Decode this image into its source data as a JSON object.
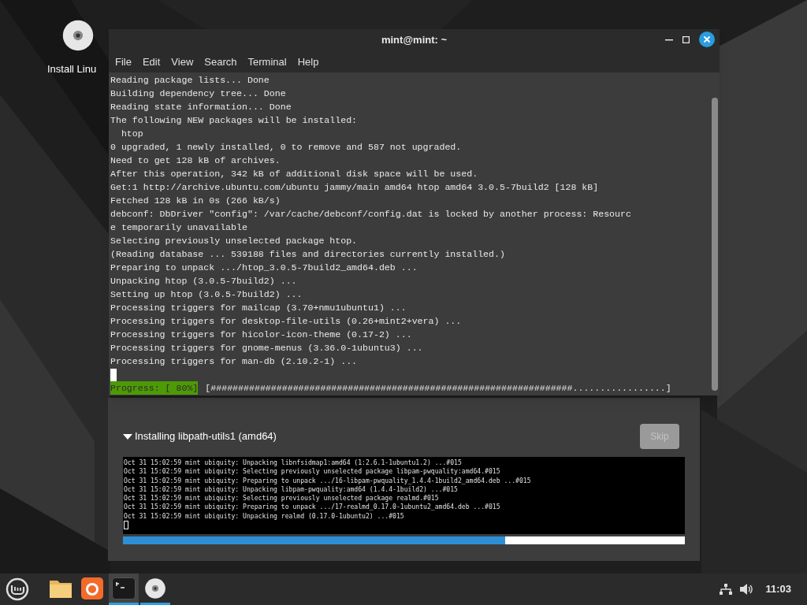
{
  "desktop": {
    "icons": [
      {
        "kind": "disc",
        "label": "Install Linu"
      }
    ]
  },
  "terminal": {
    "title": "mint@mint: ~",
    "menu": [
      "File",
      "Edit",
      "View",
      "Search",
      "Terminal",
      "Help"
    ],
    "lines": [
      "Reading package lists... Done",
      "Building dependency tree... Done",
      "Reading state information... Done",
      "The following NEW packages will be installed:",
      "  htop",
      "0 upgraded, 1 newly installed, 0 to remove and 587 not upgraded.",
      "Need to get 128 kB of archives.",
      "After this operation, 342 kB of additional disk space will be used.",
      "Get:1 http://archive.ubuntu.com/ubuntu jammy/main amd64 htop amd64 3.0.5-7build2 [128 kB]",
      "Fetched 128 kB in 0s (266 kB/s)",
      "debconf: DbDriver \"config\": /var/cache/debconf/config.dat is locked by another process: Resourc",
      "e temporarily unavailable",
      "Selecting previously unselected package htop.",
      "(Reading database ... 539188 files and directories currently installed.)",
      "Preparing to unpack .../htop_3.0.5-7build2_amd64.deb ...",
      "Unpacking htop (3.0.5-7build2) ...",
      "Setting up htop (3.0.5-7build2) ...",
      "Processing triggers for mailcap (3.70+nmu1ubuntu1) ...",
      "Processing triggers for desktop-file-utils (0.26+mint2+vera) ...",
      "Processing triggers for hicolor-icon-theme (0.17-2) ...",
      "Processing triggers for gnome-menus (3.36.0-1ubuntu3) ...",
      "Processing triggers for man-db (2.10.2-1) ..."
    ],
    "progress_label": "Progress: [ 80%]",
    "progress_bar": "[##################################################################.................]"
  },
  "installer": {
    "status": "Installing libpath-utils1 (amd64)",
    "expanded": true,
    "skip": {
      "label": "Skip",
      "disabled": true
    },
    "log": [
      "Oct 31 15:02:59 mint ubiquity: Unpacking libnfsidmap1:amd64 (1:2.6.1-1ubuntu1.2) ...#015",
      "Oct 31 15:02:59 mint ubiquity: Selecting previously unselected package libpam-pwquality:amd64.#015",
      "Oct 31 15:02:59 mint ubiquity: Preparing to unpack .../16-libpam-pwquality_1.4.4-1build2_amd64.deb ...#015",
      "Oct 31 15:02:59 mint ubiquity: Unpacking libpam-pwquality:amd64 (1.4.4-1build2) ...#015",
      "Oct 31 15:02:59 mint ubiquity: Selecting previously unselected package realmd.#015",
      "Oct 31 15:02:59 mint ubiquity: Preparing to unpack .../17-realmd_0.17.0-1ubuntu2_amd64.deb ...#015",
      "Oct 31 15:02:59 mint ubiquity: Unpacking realmd (0.17.0-1ubuntu2) ...#015"
    ],
    "progress": {
      "level": 0.68
    }
  },
  "taskbar": {
    "apps": [
      {
        "kind": "files",
        "selected": false,
        "running": false
      },
      {
        "kind": "browser",
        "selected": false,
        "running": false
      },
      {
        "kind": "terminal",
        "selected": true,
        "running": true
      },
      {
        "kind": "disc",
        "selected": false,
        "running": true
      }
    ],
    "clock": "11:03"
  }
}
